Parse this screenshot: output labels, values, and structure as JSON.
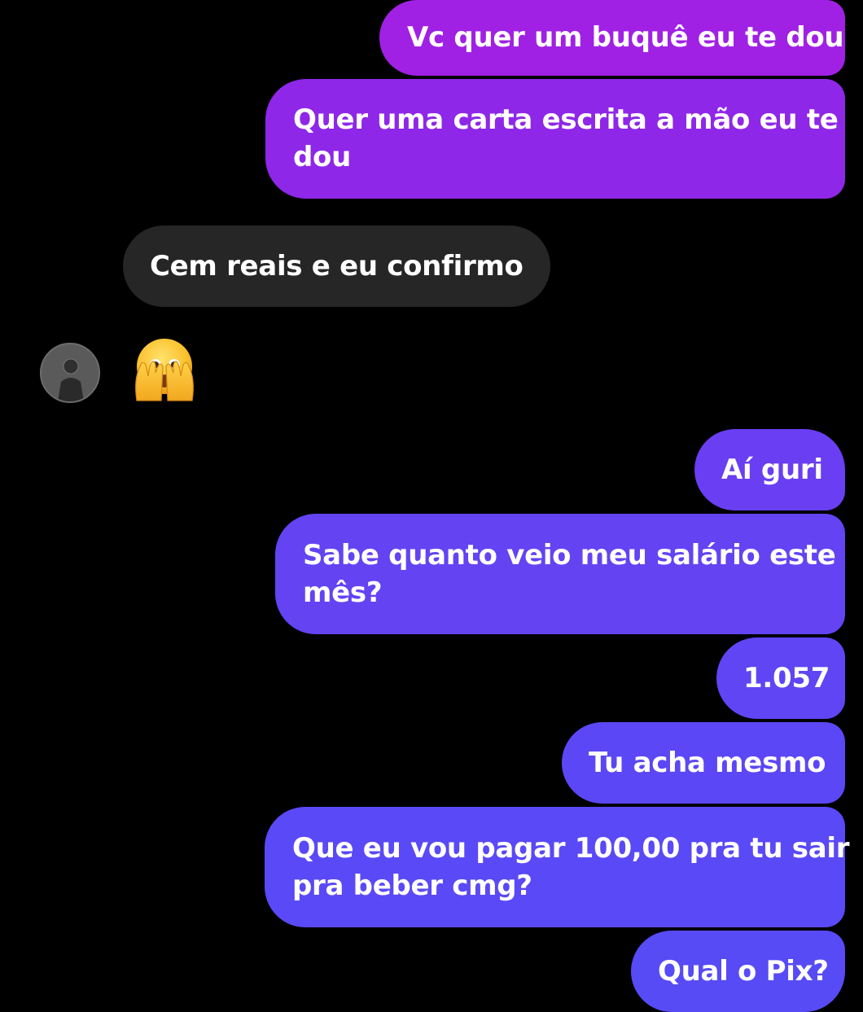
{
  "conversation": {
    "messages": [
      {
        "from": "me",
        "text": "Vc quer um buquê eu te dou",
        "lines": [
          "Vc quer um buquê eu te dou"
        ]
      },
      {
        "from": "me",
        "text": "Quer uma carta escrita a mão eu te dou",
        "lines": [
          "Quer uma carta escrita a mão eu te",
          "dou"
        ]
      },
      {
        "from": "them",
        "text": "Cem reais e eu confirmo",
        "lines": [
          "Cem reais e eu confirmo"
        ]
      },
      {
        "from": "them",
        "type": "emoji",
        "emoji_name": "face-with-open-eyes-and-hand-over-mouth-icon"
      },
      {
        "from": "me",
        "text": "Aí guri",
        "lines": [
          "Aí guri"
        ]
      },
      {
        "from": "me",
        "text": "Sabe quanto veio meu salário este mês?",
        "lines": [
          "Sabe quanto veio meu salário este",
          "mês?"
        ]
      },
      {
        "from": "me",
        "text": "1.057",
        "lines": [
          "1.057"
        ]
      },
      {
        "from": "me",
        "text": "Tu acha mesmo",
        "lines": [
          "Tu acha mesmo"
        ]
      },
      {
        "from": "me",
        "text": "Que eu vou pagar 100,00 pra tu sair pra beber cmg?",
        "lines": [
          "Que eu vou pagar 100,00 pra tu sair",
          "pra beber cmg?"
        ]
      },
      {
        "from": "me",
        "text": "Qual o Pix?",
        "lines": [
          "Qual o Pix?"
        ]
      }
    ]
  },
  "colors": {
    "background": "#000000",
    "received_bubble": "#262626",
    "sent_gradient_top": "#9b1fe6",
    "sent_gradient_bottom": "#5b45f5",
    "text": "#ffffff"
  }
}
